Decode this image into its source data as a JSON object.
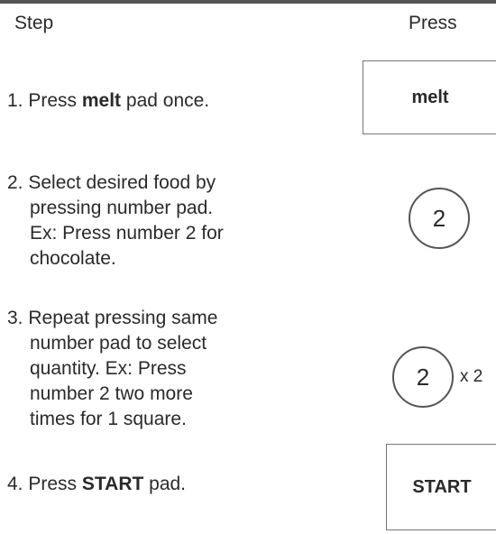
{
  "header": {
    "step_label": "Step",
    "press_label": "Press"
  },
  "steps": [
    {
      "number": "1.",
      "lines": [
        {
          "before": "Press ",
          "bold": "melt",
          "after": " pad once."
        }
      ],
      "pad": {
        "type": "box",
        "label": "melt"
      }
    },
    {
      "number": "2.",
      "lines": [
        "Select desired food by",
        "pressing number pad.",
        "Ex: Press number 2 for",
        "chocolate."
      ],
      "pad": {
        "type": "circle",
        "label": "2"
      }
    },
    {
      "number": "3.",
      "lines": [
        "Repeat pressing same",
        "number pad to select",
        "quantity. Ex: Press",
        "number 2 two more",
        "times for 1 square."
      ],
      "pad": {
        "type": "circle",
        "label": "2",
        "suffix": "x 2"
      }
    },
    {
      "number": "4.",
      "lines": [
        {
          "before": "Press ",
          "bold": "START",
          "after": " pad."
        }
      ],
      "pad": {
        "type": "box",
        "label": "START"
      }
    }
  ]
}
